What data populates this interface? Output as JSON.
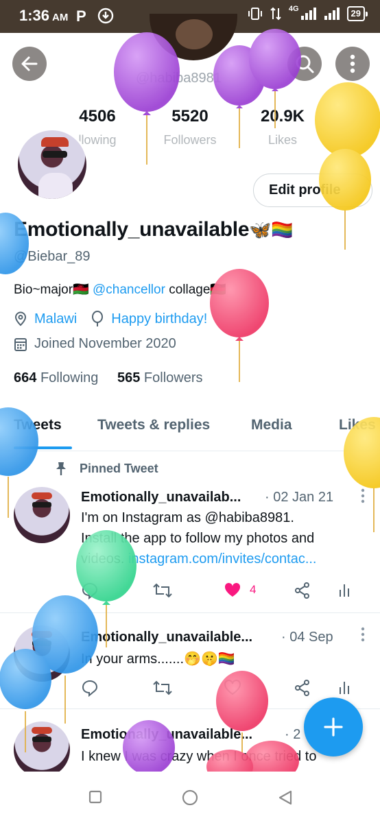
{
  "status_bar": {
    "time": "1:36",
    "ampm": "AM",
    "network": "4G",
    "battery": "29"
  },
  "header": {
    "handle": "@habiba8981",
    "stats": [
      {
        "value": "4506",
        "label": "llowing"
      },
      {
        "value": "5520",
        "label": "Followers"
      },
      {
        "value": "20.9K",
        "label": "Likes"
      }
    ]
  },
  "profile": {
    "edit_label": "Edit profile",
    "name": "Emotionally_unavailable",
    "name_emoji": "🦋🏳️‍🌈",
    "handle": "@Biebar_89",
    "bio_prefix": "Bio~major🇲🇼",
    "bio_link": "@chancellor",
    "bio_suffix": "collage🇲🇼",
    "location": "Malawi",
    "birthday": "Happy birthday!",
    "joined": "Joined November 2020",
    "following_count": "664",
    "following_label": "Following",
    "followers_count": "565",
    "followers_label": "Followers"
  },
  "tabs": [
    "Tweets",
    "Tweets & replies",
    "Media",
    "Likes"
  ],
  "pinned_label": "Pinned Tweet",
  "tweets": [
    {
      "name": "Emotionally_unavailab...",
      "date": "· 02 Jan 21",
      "line1": "I'm on Instagram as @habiba8981.",
      "line2": "Install the app to follow my photos and",
      "line3_prefix": "videos.",
      "line3_link": "instagram.com/invites/contac...",
      "likes": "4"
    },
    {
      "name": "Emotionally_unavailable...",
      "date": "· 04 Sep",
      "line1": "In your arms.......🤭🤫🏳️‍🌈"
    },
    {
      "name": "Emotionally_unavailable...",
      "date": "· 2",
      "line1": "I knew I was crazy when I once tried to"
    }
  ],
  "colors": {
    "accent": "#1d9bf0",
    "like": "#f91880",
    "status_bar": "#463a2f",
    "balloon_purple": "#a347d9",
    "balloon_yellow": "#f7d13a",
    "balloon_blue": "#3aa0ee",
    "balloon_red": "#f0456e",
    "balloon_green": "#3fdc98"
  },
  "icons": [
    "back-arrow-icon",
    "search-icon",
    "more-vertical-icon",
    "location-icon",
    "balloon-icon",
    "calendar-icon",
    "pin-icon",
    "reply-icon",
    "retweet-icon",
    "heart-icon",
    "share-icon",
    "analytics-icon",
    "plus-icon"
  ]
}
